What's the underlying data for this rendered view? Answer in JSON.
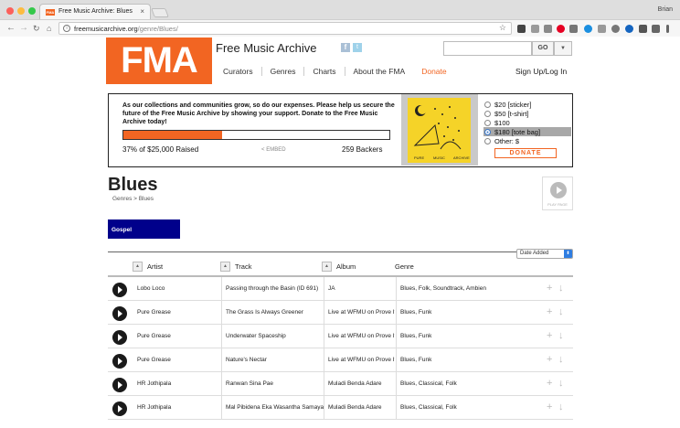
{
  "browser": {
    "tab_title": "Free Music Archive: Blues",
    "tab_favicon": "FMA",
    "tab_close": "×",
    "user": "Brian",
    "url_host": "freemusicarchive.org",
    "url_path": "/genre/Blues/",
    "icons": {
      "back": "←",
      "forward": "→",
      "reload": "↻",
      "home": "⌂",
      "star": "☆",
      "info": "i"
    }
  },
  "site": {
    "logo": "FMA",
    "title": "Free Music Archive",
    "social": {
      "facebook": "f",
      "twitter": "t"
    },
    "search": {
      "value": "",
      "placeholder": "",
      "go": "GO",
      "dropdown": "▼"
    },
    "nav": [
      "Curators",
      "Genres",
      "Charts",
      "About the FMA"
    ],
    "nav_donate": "Donate",
    "signup": "Sign Up/Log In"
  },
  "donation": {
    "message": "As our collections and communities grow, so do our expenses. Please help us secure the future of the Free Music Archive by showing your support. Donate to the Free Music Archive today!",
    "progress_percent": 37,
    "raised": "37% of $25,000 Raised",
    "embed": "EMBED",
    "backers": "259 Backers",
    "options": [
      "$20 [sticker]",
      "$50 [t-shirt]",
      "$100",
      "$180 [tote bag]",
      "Other: $"
    ],
    "selected_index": 3,
    "donate_label": "DONATE",
    "album_caption": [
      "PURE",
      "MUSIC",
      "ARCHIVE"
    ]
  },
  "genre": {
    "title": "Blues",
    "breadcrumb": "Genres > Blues",
    "play_page_label": "PLAY PAGE",
    "subgenres": [
      "Gospel"
    ]
  },
  "table": {
    "sort": "Date Added",
    "sort_arrow": "⬍",
    "headers": {
      "artist": "Artist",
      "track": "Track",
      "album": "Album",
      "genre": "Genre"
    },
    "sort_icon": "▲",
    "add_icon": "+",
    "download_icon": "↓",
    "rows": [
      {
        "artist": "Lobo Loco",
        "track": "Passing through the Basin (ID 691)",
        "album": "JA",
        "genre": "Blues, Folk, Soundtrack, Ambient"
      },
      {
        "artist": "Pure Grease",
        "track": "The Grass Is Always Greener",
        "album": "Live at WFMU on Prove It",
        "genre": "Blues, Funk"
      },
      {
        "artist": "Pure Grease",
        "track": "Underwater Spaceship",
        "album": "Live at WFMU on Prove It",
        "genre": "Blues, Funk"
      },
      {
        "artist": "Pure Grease",
        "track": "Nature's Nectar",
        "album": "Live at WFMU on Prove It",
        "genre": "Blues, Funk"
      },
      {
        "artist": "HR Jothipala",
        "track": "Ranwan Sina Pae",
        "album": "Muladi Benda Adare",
        "genre": "Blues, Classical, Folk"
      },
      {
        "artist": "HR Jothipala",
        "track": "Mal Pibidena Eka Wasantha Samayaka",
        "album": "Muladi Benda Adare",
        "genre": "Blues, Classical, Folk"
      }
    ]
  },
  "colors": {
    "brand": "#f26522",
    "subgenre": "#00008b",
    "select": "#2f7de1"
  }
}
